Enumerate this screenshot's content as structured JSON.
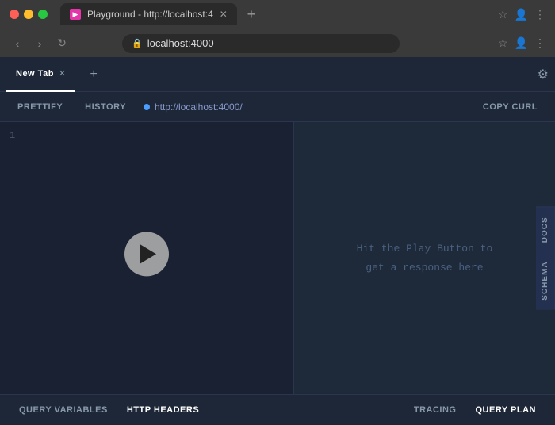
{
  "browser": {
    "title": "Playground - http://localhost:4",
    "address": "localhost:4000",
    "tab_label": "New Tab",
    "new_tab_icon": "+"
  },
  "app": {
    "tabs": [
      {
        "id": "new-tab",
        "label": "New Tab",
        "active": true
      },
      {
        "id": "add",
        "label": "+",
        "active": false
      }
    ],
    "gear_icon": "⚙",
    "toolbar": {
      "prettify_label": "PRETTIFY",
      "history_label": "HISTORY",
      "url": "http://localhost:4000/",
      "copy_curl_label": "COPY CURL"
    },
    "editor": {
      "line_number": "1"
    },
    "response": {
      "placeholder_line1": "Hit the Play Button to",
      "placeholder_line2": "get a response here"
    },
    "side_tabs": [
      {
        "label": "DOCS"
      },
      {
        "label": "SCHEMA"
      }
    ],
    "bottom_tabs_left": [
      {
        "label": "QUERY VARIABLES",
        "active": false
      },
      {
        "label": "HTTP HEADERS",
        "active": true
      }
    ],
    "bottom_tabs_right": [
      {
        "label": "TRACING",
        "active": false
      },
      {
        "label": "QUERY PLAN",
        "active": true
      }
    ]
  }
}
